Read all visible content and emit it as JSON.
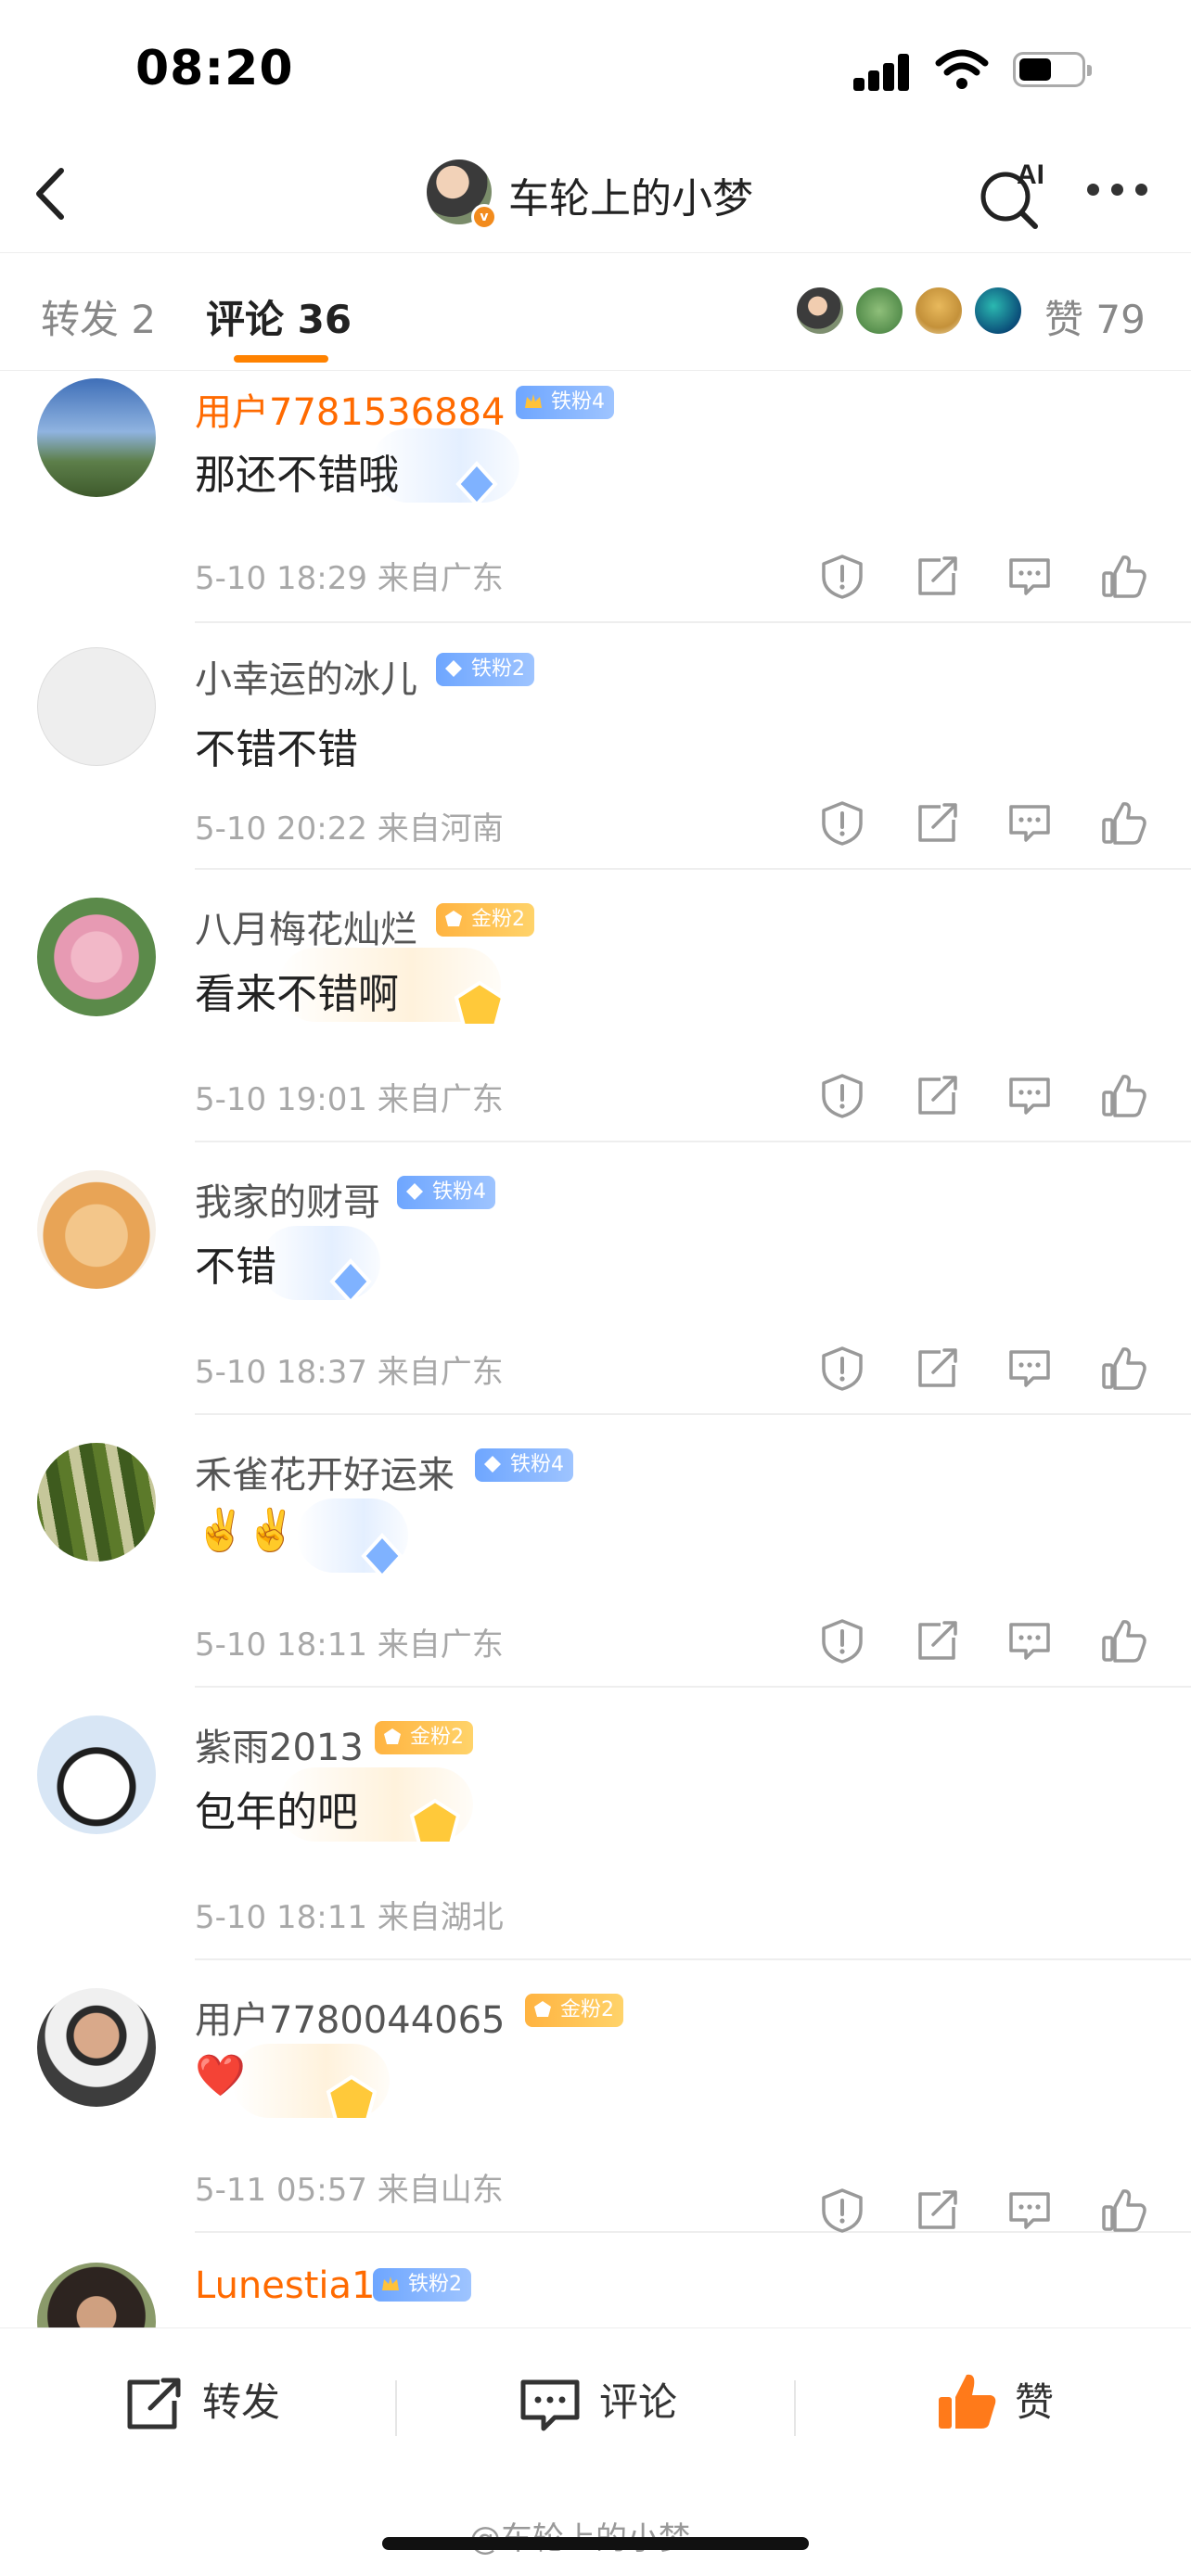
{
  "status": {
    "time": "08:20"
  },
  "header": {
    "title": "车轮上的小梦",
    "ai_label": "AI"
  },
  "tabs": {
    "repost": "转发 2",
    "comments": "评论 36",
    "likes_label": "赞",
    "likes_count": "79"
  },
  "comments": [
    {
      "user": "用户7781536884",
      "badge": "铁粉4",
      "text": "那还不错哦",
      "time": "5-10 18:29",
      "loc": "来自广东"
    },
    {
      "user": "小幸运的冰儿",
      "badge": "铁粉2",
      "text": "不错不错",
      "time": "5-10 20:22",
      "loc": "来自河南"
    },
    {
      "user": "八月梅花灿烂",
      "badge": "金粉2",
      "text": "看来不错啊",
      "time": "5-10 19:01",
      "loc": "来自广东"
    },
    {
      "user": "我家的财哥",
      "badge": "铁粉4",
      "text": "不错",
      "time": "5-10 18:37",
      "loc": "来自广东"
    },
    {
      "user": "禾雀花开好运来",
      "badge": "铁粉4",
      "text": "✌️✌️",
      "time": "5-10 18:11",
      "loc": "来自广东"
    },
    {
      "user": "紫雨2013",
      "badge": "金粉2",
      "text": "包年的吧",
      "time": "5-10 18:11",
      "loc": "来自湖北"
    },
    {
      "user": "用户7780044065",
      "badge": "金粉2",
      "text": "❤️",
      "time": "5-11 05:57",
      "loc": "来自山东"
    },
    {
      "user": "Lunestia1",
      "badge": "铁粉2"
    }
  ],
  "bottom": {
    "repost": "转发",
    "comment": "评论",
    "like": "赞"
  },
  "watermark": "@车轮上的小梦",
  "colors": {
    "accent": "#ff8200",
    "vip_name": "#ff6a00",
    "iron_badge": "#6ea6ff",
    "gold_badge": "#ffb340"
  }
}
